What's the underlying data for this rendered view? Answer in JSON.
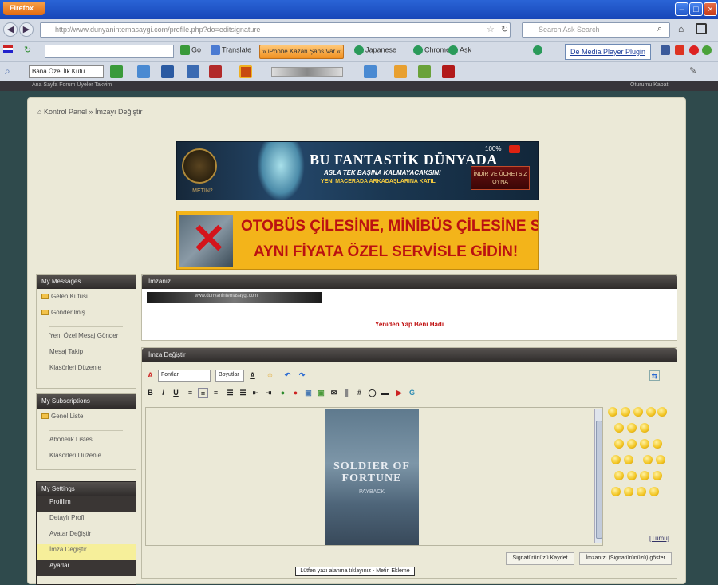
{
  "browser": {
    "app_button": "Firefox",
    "window_controls": [
      "–",
      "□",
      "×"
    ],
    "url": "http://www.dunyanintemasaygi.com/profile.php?do=editsignature",
    "search_placeholder": "Search Ask Search",
    "bookmark_items": [
      "Go",
      "Translate",
      "Japanese",
      "Chrome",
      "Ask"
    ],
    "iphone_button": "» iPhone Kazan Şans Var «",
    "dmp_button": "De Media Player Plugin",
    "toolbar_select": "Bana Özel İlk Kutu"
  },
  "site_strip": {
    "left": "Ana Sayfa   Forum   Üyeler   Takvim",
    "right": "Oturumu Kapat"
  },
  "breadcrumb": "Kontrol Panel » İmzayı Değiştir",
  "banner1": {
    "line1": "BU FANTASTİK DÜNYADA",
    "line2": "ASLA TEK BAŞINA KALMAYACAKSIN!",
    "line3": "YENİ MACERADA ARKADAŞLARINA KATIL",
    "brand": "METIN2",
    "pct": "100%",
    "cta": "İNDİR VE ÜCRETSİZ OYNA"
  },
  "banner2": {
    "line1": "OTOBÜS ÇİLESİNE, MİNİBÜS ÇİLESİNE SON",
    "line2": "AYNI FİYATA ÖZEL SERVİSLE GİDİN!"
  },
  "sidebar": {
    "messages": {
      "title": "My Messages",
      "folders": [
        "Gelen Kutusu",
        "Gönderilmiş"
      ],
      "items": [
        "Yeni Özel Mesaj Gönder",
        "Mesaj Takip",
        "Klasörleri Düzenle"
      ]
    },
    "subscriptions": {
      "title": "My Subscriptions",
      "folders": [
        "Genel Liste"
      ],
      "items": [
        "Abonelik Listesi",
        "Klasörleri Düzenle"
      ]
    },
    "settings": {
      "title": "My Settings",
      "items": [
        "Profilim",
        "Detaylı Profil",
        "Avatar Değiştir",
        "İmza Değiştir",
        "Ayarlar"
      ]
    }
  },
  "signature_preview": {
    "title": "İmzanız",
    "bar_text": "www.dunyanintemasaygi.com",
    "red_text": "Yeniden Yap Beni Hadi"
  },
  "editor": {
    "title": "İmza Değiştir",
    "font_select": "Fontlar",
    "size_select": "Boyutlar",
    "cover_title": "SOLDIER OF FORTUNE",
    "cover_sub": "PAYBACK",
    "more_link": "[Tümü]",
    "save_button": "Signatürünüzü Kaydet",
    "show_button": "İmzanızı (Signatürünüzü) göster"
  },
  "tooltip": "Lütfen yazı alanına tıklayınız - Metin Ekleme"
}
